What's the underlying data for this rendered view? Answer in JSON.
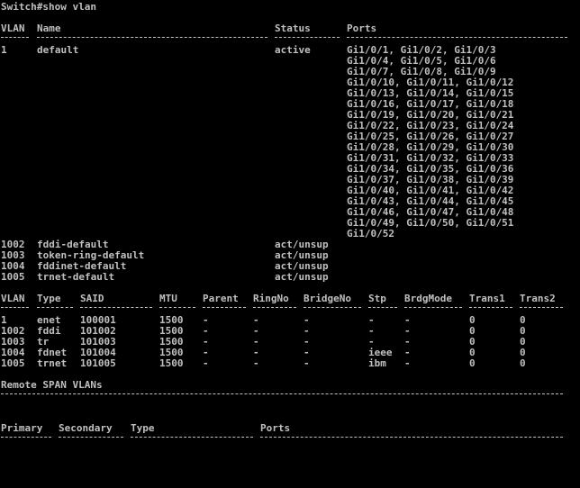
{
  "prompt_line": "Switch#show vlan",
  "vlan_table": {
    "headers": {
      "vlan": "VLAN",
      "name": "Name",
      "status": "Status",
      "ports": "Ports"
    },
    "rows": [
      {
        "vlan": "1",
        "name": "default",
        "status": "active",
        "ports": [
          "Gi1/0/1, Gi1/0/2, Gi1/0/3",
          "Gi1/0/4, Gi1/0/5, Gi1/0/6",
          "Gi1/0/7, Gi1/0/8, Gi1/0/9",
          "Gi1/0/10, Gi1/0/11, Gi1/0/12",
          "Gi1/0/13, Gi1/0/14, Gi1/0/15",
          "Gi1/0/16, Gi1/0/17, Gi1/0/18",
          "Gi1/0/19, Gi1/0/20, Gi1/0/21",
          "Gi1/0/22, Gi1/0/23, Gi1/0/24",
          "Gi1/0/25, Gi1/0/26, Gi1/0/27",
          "Gi1/0/28, Gi1/0/29, Gi1/0/30",
          "Gi1/0/31, Gi1/0/32, Gi1/0/33",
          "Gi1/0/34, Gi1/0/35, Gi1/0/36",
          "Gi1/0/37, Gi1/0/38, Gi1/0/39",
          "Gi1/0/40, Gi1/0/41, Gi1/0/42",
          "Gi1/0/43, Gi1/0/44, Gi1/0/45",
          "Gi1/0/46, Gi1/0/47, Gi1/0/48",
          "Gi1/0/49, Gi1/0/50, Gi1/0/51",
          "Gi1/0/52"
        ]
      },
      {
        "vlan": "1002",
        "name": "fddi-default",
        "status": "act/unsup",
        "ports": []
      },
      {
        "vlan": "1003",
        "name": "token-ring-default",
        "status": "act/unsup",
        "ports": []
      },
      {
        "vlan": "1004",
        "name": "fddinet-default",
        "status": "act/unsup",
        "ports": []
      },
      {
        "vlan": "1005",
        "name": "trnet-default",
        "status": "act/unsup",
        "ports": []
      }
    ]
  },
  "type_table": {
    "headers": [
      "VLAN",
      "Type",
      "SAID",
      "MTU",
      "Parent",
      "RingNo",
      "BridgeNo",
      "Stp",
      "BrdgMode",
      "Trans1",
      "Trans2"
    ],
    "rows": [
      [
        "1",
        "enet",
        "100001",
        "1500",
        "-",
        "-",
        "-",
        "-",
        "-",
        "0",
        "0"
      ],
      [
        "1002",
        "fddi",
        "101002",
        "1500",
        "-",
        "-",
        "-",
        "-",
        "-",
        "0",
        "0"
      ],
      [
        "1003",
        "tr",
        "101003",
        "1500",
        "-",
        "-",
        "-",
        "-",
        "-",
        "0",
        "0"
      ],
      [
        "1004",
        "fdnet",
        "101004",
        "1500",
        "-",
        "-",
        "-",
        "ieee",
        "-",
        "0",
        "0"
      ],
      [
        "1005",
        "trnet",
        "101005",
        "1500",
        "-",
        "-",
        "-",
        "ibm",
        "-",
        "0",
        "0"
      ]
    ]
  },
  "remote_span": {
    "title": "Remote SPAN VLANs"
  },
  "pvlan_table": {
    "headers": [
      "Primary",
      "Secondary",
      "Type",
      "Ports"
    ]
  },
  "colors": {
    "background": "#000000",
    "text": "#c0c0c0"
  }
}
